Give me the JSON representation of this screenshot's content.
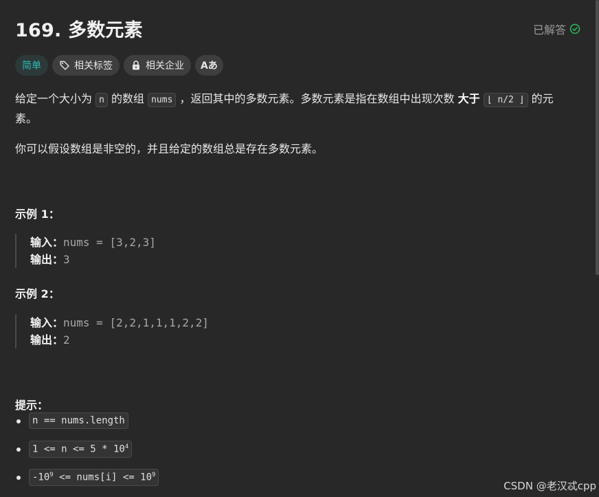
{
  "header": {
    "title": "169. 多数元素",
    "solved_label": "已解答",
    "solved_icon": "check-circle-icon",
    "solved_color": "#2cbb5d"
  },
  "tags": [
    {
      "label": "简单",
      "icon": null
    },
    {
      "label": "相关标签",
      "icon": "tag-icon"
    },
    {
      "label": "相关企业",
      "icon": "lock-icon"
    },
    {
      "label": "Aあ",
      "icon": "translate-icon"
    }
  ],
  "description": {
    "p1_a": "给定一个大小为 ",
    "p1_code1": "n",
    "p1_b": " 的数组 ",
    "p1_code2": "nums",
    "p1_c": " ，返回其中的多数元素。多数元素是指在数组中出现次数 ",
    "p1_bold": "大于",
    "p1_code3": "⌊ n/2 ⌋",
    "p1_d": " 的元素。",
    "p2": "你可以假设数组是非空的，并且给定的数组总是存在多数元素。"
  },
  "examples": [
    {
      "title": "示例 1：",
      "input_label": "输入：",
      "input": "nums = [3,2,3]",
      "output_label": "输出：",
      "output": "3"
    },
    {
      "title": "示例 2：",
      "input_label": "输入：",
      "input": "nums = [2,2,1,1,1,2,2]",
      "output_label": "输出：",
      "output": "2"
    }
  ],
  "hints": {
    "title": "提示：",
    "h1": "n == nums.length",
    "h2_a": "1 <= n <= 5 * 10",
    "h2_sup": "4",
    "h3_a": "-10",
    "h3_sup1": "9",
    "h3_b": " <= nums[i] <= 10",
    "h3_sup2": "9"
  },
  "watermark": "CSDN @老汉忒cpp"
}
